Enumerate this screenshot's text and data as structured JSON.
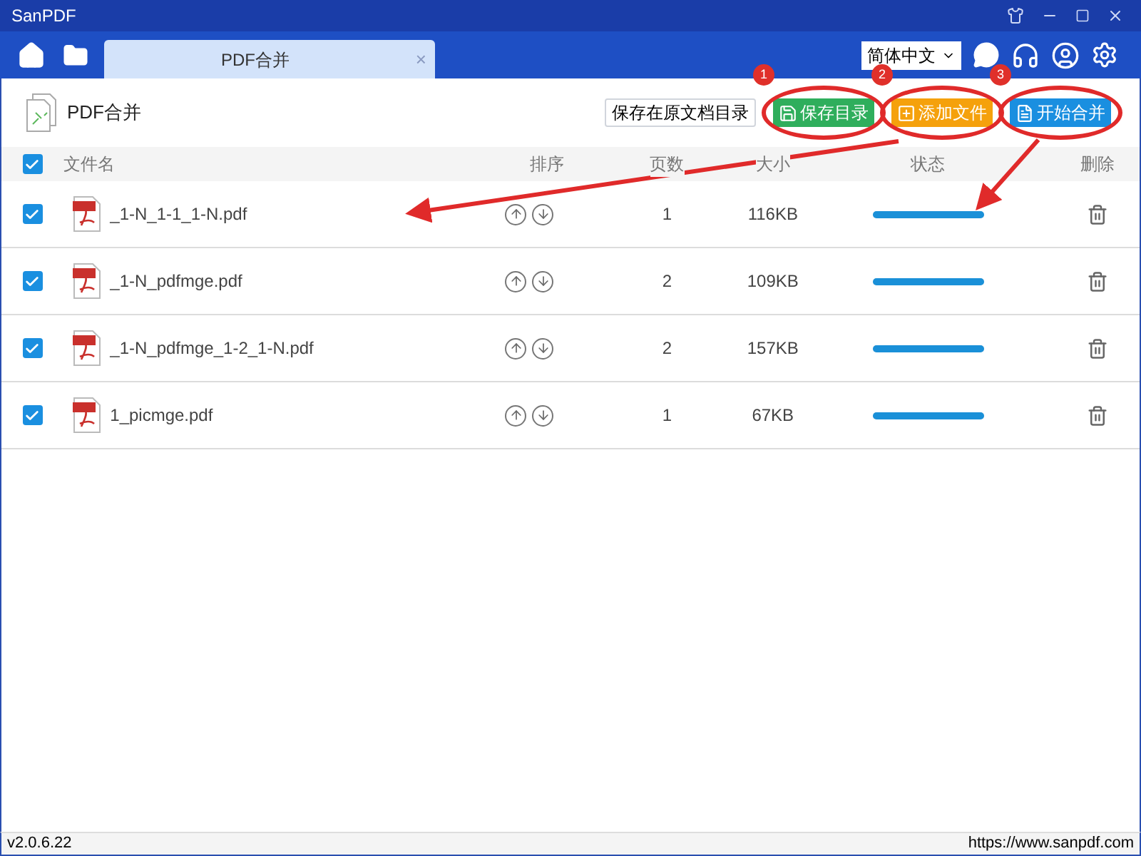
{
  "window": {
    "title": "SanPDF"
  },
  "tabs": [
    {
      "label": "PDF合并",
      "close": "×",
      "selected": true
    }
  ],
  "language": {
    "value": "简体中文"
  },
  "page_title": "PDF合并",
  "buttons": [
    {
      "label": "保存在原文档目录",
      "kind": "plain"
    },
    {
      "label": "保存目录",
      "kind": "save",
      "annotation": "1"
    },
    {
      "label": "添加文件",
      "kind": "add",
      "annotation": "2"
    },
    {
      "label": "开始合并",
      "kind": "start",
      "annotation": "3"
    }
  ],
  "table": {
    "all_checked": true,
    "columns": [
      "文件名",
      "排序",
      "页数",
      "大小",
      "状态",
      "删除"
    ],
    "rows": [
      {
        "checked": true,
        "name": "_1-N_1-1_1-N.pdf",
        "pages": "1",
        "size": "116KB",
        "level": 1
      },
      {
        "checked": true,
        "name": "_1-N_pdfmge.pdf",
        "pages": "2",
        "size": "109KB",
        "level": 1
      },
      {
        "checked": true,
        "name": "_1-N_pdfmge_1-2_1-N.pdf",
        "pages": "2",
        "size": "157KB",
        "level": 1
      },
      {
        "checked": true,
        "name": "1_picmge.pdf",
        "pages": "1",
        "size": "67KB",
        "level": 1
      }
    ]
  },
  "status_bar": {
    "version": "v2.0.6.22",
    "url": "https://www.sanpdf.com"
  }
}
